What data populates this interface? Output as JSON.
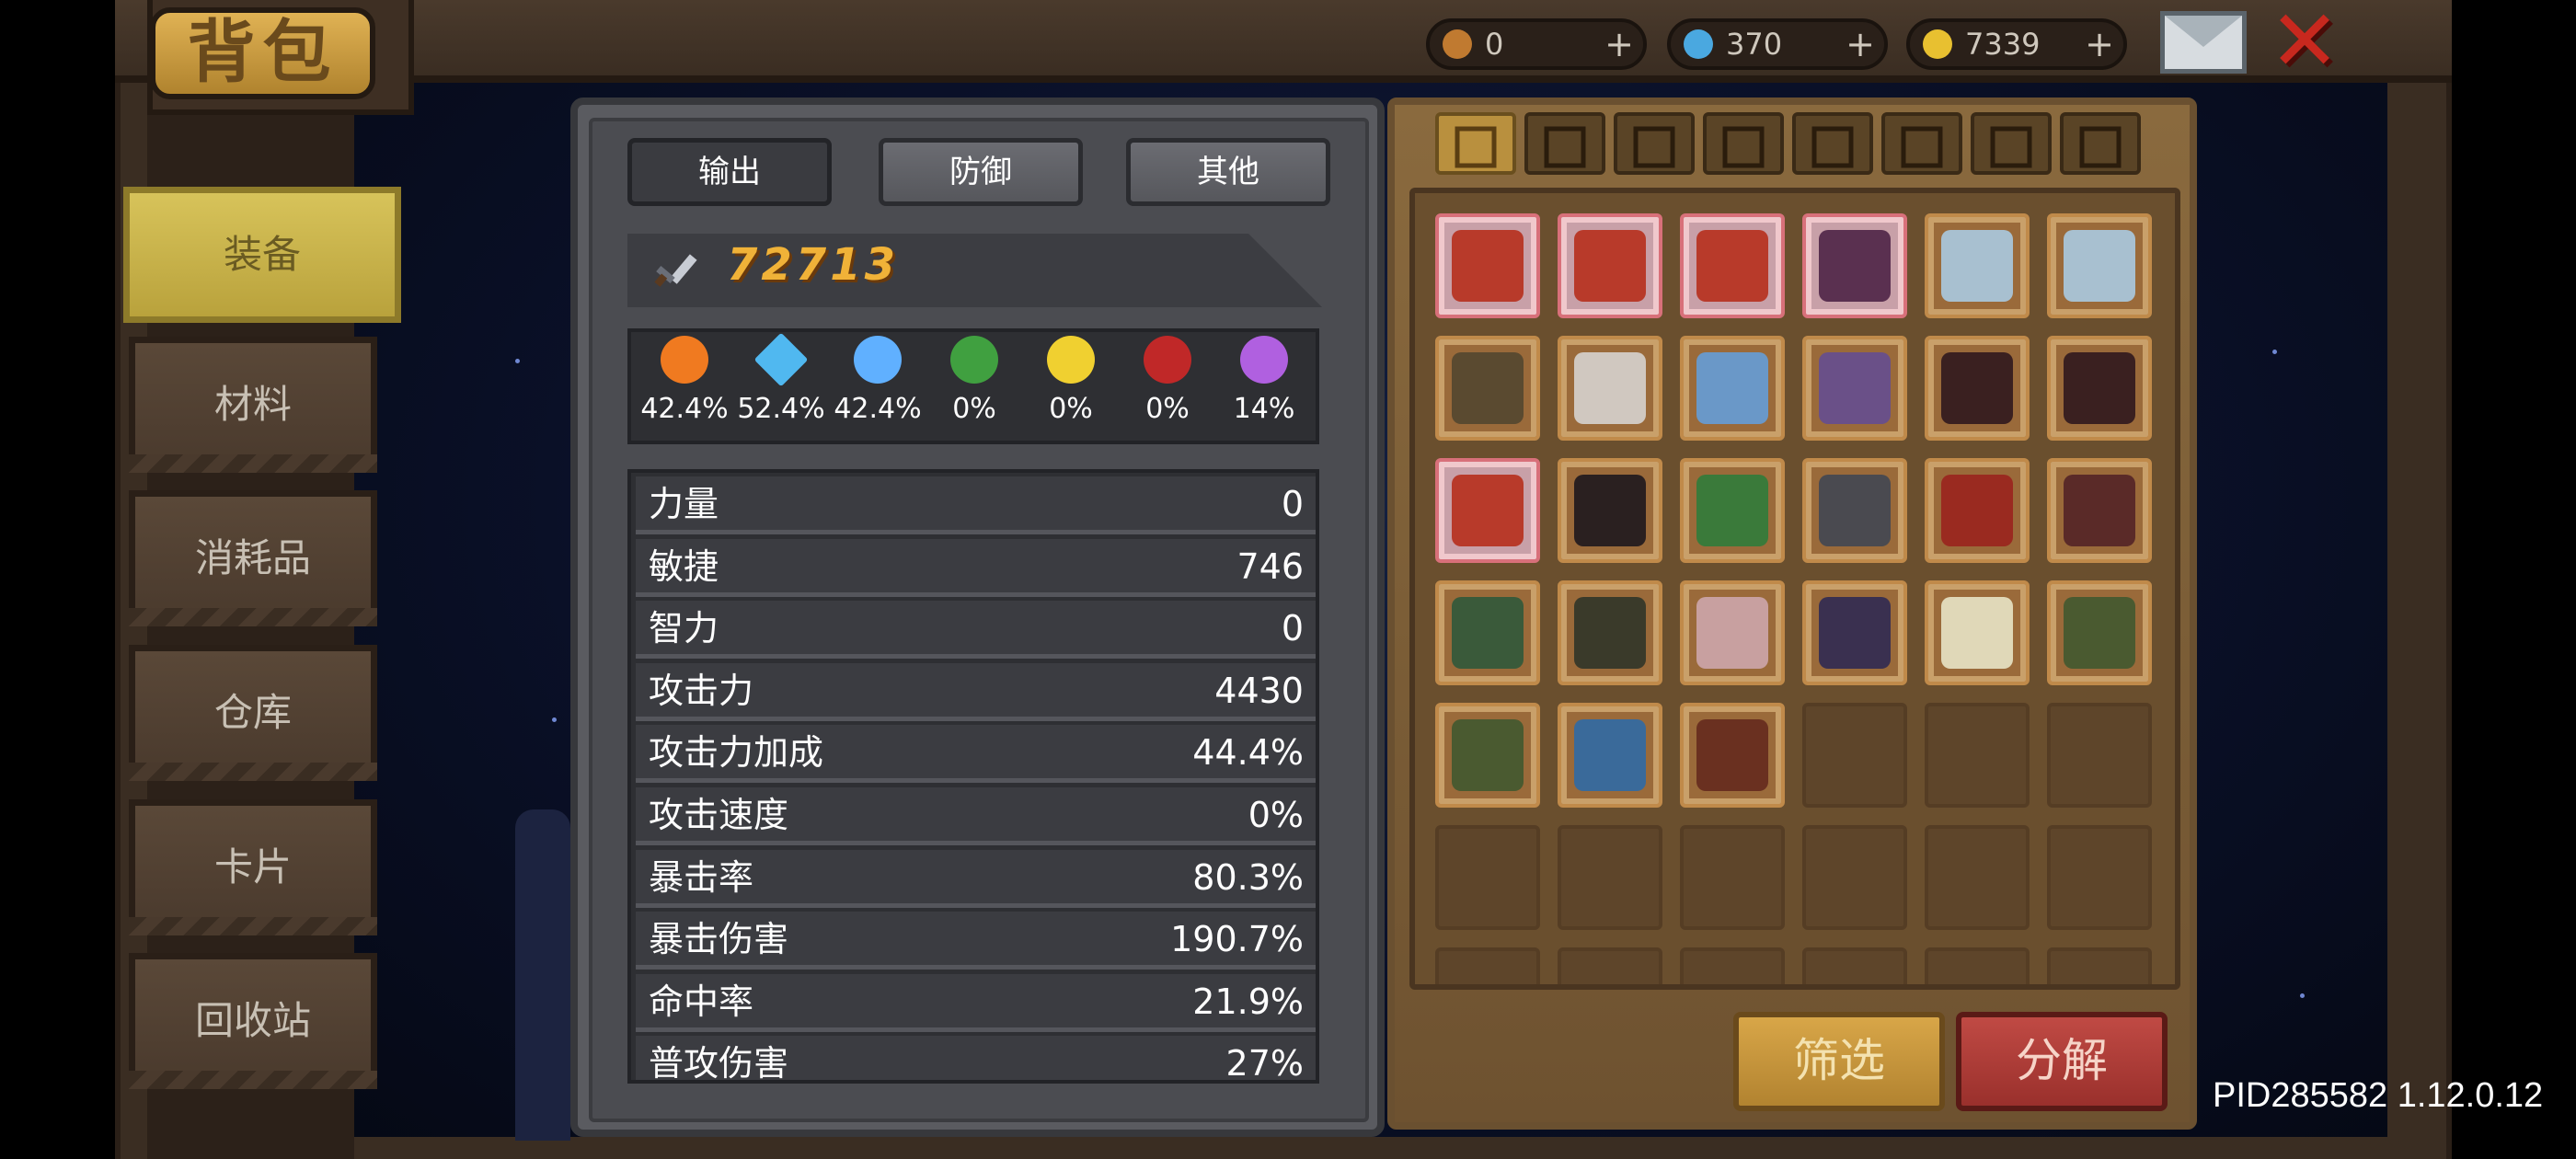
{
  "window": {
    "title": "背包"
  },
  "currency": [
    {
      "name": "key-currency",
      "icon": "key-icon",
      "value": "0",
      "plus": "+",
      "color": "#c07a30"
    },
    {
      "name": "gem-currency",
      "icon": "gem-icon",
      "value": "370",
      "plus": "+",
      "color": "#4aa8e0"
    },
    {
      "name": "gold-currency",
      "icon": "gold-coin-icon",
      "value": "7339",
      "plus": "+",
      "color": "#e8c030"
    }
  ],
  "header": {
    "mail_icon": "mail-icon",
    "close_icon": "close-icon"
  },
  "sidebar": {
    "items": [
      {
        "label": "装备",
        "active": true
      },
      {
        "label": "材料"
      },
      {
        "label": "消耗品",
        "badge": "!"
      },
      {
        "label": "仓库"
      },
      {
        "label": "卡片"
      },
      {
        "label": "回收站"
      }
    ]
  },
  "stats": {
    "tabs": [
      {
        "label": "输出",
        "active": true
      },
      {
        "label": "防御"
      },
      {
        "label": "其他"
      }
    ],
    "power_icon": "sword-icon",
    "power": "72713",
    "elements": [
      {
        "icon": "fire-icon",
        "value": "42.4%",
        "color": "#f07a20"
      },
      {
        "icon": "ice-crystal-icon",
        "value": "52.4%",
        "color": "#50b8f0"
      },
      {
        "icon": "lightning-icon",
        "value": "42.4%",
        "color": "#60b0ff"
      },
      {
        "icon": "poison-skull-icon",
        "value": "0%",
        "color": "#40a040"
      },
      {
        "icon": "light-sun-icon",
        "value": "0%",
        "color": "#f0d030"
      },
      {
        "icon": "dark-moon-icon",
        "value": "0%",
        "color": "#c02828"
      },
      {
        "icon": "arcane-star-icon",
        "value": "14%",
        "color": "#b060e0"
      }
    ],
    "rows": [
      {
        "label": "力量",
        "value": "0"
      },
      {
        "label": "敏捷",
        "value": "746"
      },
      {
        "label": "智力",
        "value": "0"
      },
      {
        "label": "攻击力",
        "value": "4430"
      },
      {
        "label": "攻击力加成",
        "value": "44.4%"
      },
      {
        "label": "攻击速度",
        "value": "0%"
      },
      {
        "label": "暴击率",
        "value": "80.3%"
      },
      {
        "label": "暴击伤害",
        "value": "190.7%"
      },
      {
        "label": "命中率",
        "value": "21.9%"
      },
      {
        "label": "普攻伤害",
        "value": "27%"
      }
    ]
  },
  "inventory": {
    "categories": [
      {
        "icon": "grid-all-icon",
        "active": true
      },
      {
        "icon": "sword-category-icon"
      },
      {
        "icon": "armor-category-icon"
      },
      {
        "icon": "helmet-category-icon"
      },
      {
        "icon": "boots-category-icon"
      },
      {
        "icon": "necklace-category-icon"
      },
      {
        "icon": "ring-category-icon"
      },
      {
        "icon": "gear-category-icon"
      }
    ],
    "items": [
      {
        "icon": "crossbow-icon",
        "rarity": "pink",
        "color": "#b83a2a"
      },
      {
        "icon": "crossbow-icon",
        "rarity": "pink",
        "color": "#b83a2a"
      },
      {
        "icon": "crossbow-icon",
        "rarity": "pink",
        "color": "#b83a2a"
      },
      {
        "icon": "dark-sword-icon",
        "rarity": "pink",
        "color": "#5a3050"
      },
      {
        "icon": "ghost-cloak-icon",
        "rarity": "normal",
        "color": "#a8c0d0"
      },
      {
        "icon": "ghost-cloak-icon",
        "rarity": "normal",
        "color": "#a8c0d0"
      },
      {
        "icon": "hood-icon",
        "rarity": "normal",
        "color": "#5a4a30"
      },
      {
        "icon": "scroll-armor-icon",
        "rarity": "normal",
        "color": "#d0c8c0"
      },
      {
        "icon": "ice-boots-icon",
        "rarity": "normal",
        "color": "#6a98c8"
      },
      {
        "icon": "purple-boots-icon",
        "rarity": "normal",
        "color": "#6a5088"
      },
      {
        "icon": "dark-blade-icon",
        "rarity": "normal",
        "color": "#3a2020"
      },
      {
        "icon": "dark-blade-icon",
        "rarity": "normal",
        "color": "#3a2020"
      },
      {
        "icon": "crossbow-icon",
        "rarity": "pink",
        "color": "#b83a2a"
      },
      {
        "icon": "staff-icon",
        "rarity": "normal",
        "color": "#2a2020"
      },
      {
        "icon": "green-blade-icon",
        "rarity": "normal",
        "color": "#3a7a3a"
      },
      {
        "icon": "iron-helmet-icon",
        "rarity": "normal",
        "color": "#4a4a50"
      },
      {
        "icon": "red-armor-icon",
        "rarity": "normal",
        "color": "#9a2a20"
      },
      {
        "icon": "red-armor-icon",
        "rarity": "normal",
        "color": "#5a2a28"
      },
      {
        "icon": "turtle-shell-icon",
        "rarity": "normal",
        "color": "#3a5a3a"
      },
      {
        "icon": "green-ring-icon",
        "rarity": "normal",
        "color": "#3a3a2a"
      },
      {
        "icon": "pink-ring-icon",
        "rarity": "normal",
        "color": "#c8a0a0"
      },
      {
        "icon": "jewel-amulet-icon",
        "rarity": "normal",
        "color": "#3a3050"
      },
      {
        "icon": "white-hood-icon",
        "rarity": "normal",
        "color": "#e0d8b8"
      },
      {
        "icon": "hood-icon",
        "rarity": "normal",
        "color": "#4a5a30"
      },
      {
        "icon": "hood-icon",
        "rarity": "normal",
        "color": "#4a5a30"
      },
      {
        "icon": "blue-robe-icon",
        "rarity": "normal",
        "color": "#3a6a9a"
      },
      {
        "icon": "fire-armor-icon",
        "rarity": "normal",
        "color": "#6a3020"
      }
    ],
    "filter_label": "筛选",
    "decompose_label": "分解"
  },
  "footer": {
    "pid": "PID285582 1.12.0.12"
  }
}
